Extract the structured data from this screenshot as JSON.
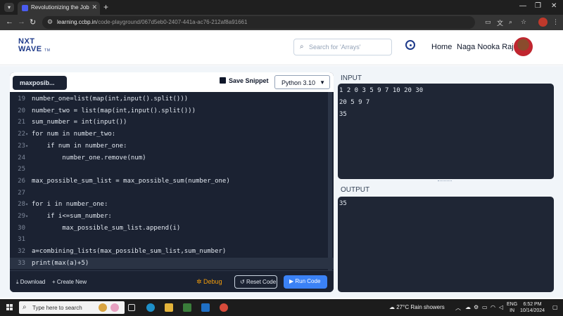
{
  "browser": {
    "tab_title": "Revolutionizing the Job Market",
    "url_host": "learning.ccbp.in",
    "url_path": "/code-playground/067d5eb0-2407-441a-ac76-212af8a91661"
  },
  "header": {
    "logo_line1": "NXT",
    "logo_line2": "WAVE",
    "logo_tm": "TM",
    "search_placeholder": "Search for 'Arrays'",
    "nav_home": "Home",
    "user_name": "Naga Nooka Raju"
  },
  "editor": {
    "file_tab": "maxposib...",
    "save_label": "Save Snippet",
    "language": "Python 3.10",
    "lines": [
      {
        "n": "19",
        "code": "number_one=list(map(int,input().split()))",
        "fold": ""
      },
      {
        "n": "20",
        "code": "number_two = list(map(int,input().split()))",
        "fold": ""
      },
      {
        "n": "21",
        "code": "sum_number = int(input())",
        "fold": ""
      },
      {
        "n": "22",
        "code": "for num in number_two:",
        "fold": "▾"
      },
      {
        "n": "23",
        "code": "    if num in number_one:",
        "fold": "▾"
      },
      {
        "n": "24",
        "code": "        number_one.remove(num)",
        "fold": ""
      },
      {
        "n": "25",
        "code": "",
        "fold": ""
      },
      {
        "n": "26",
        "code": "max_possible_sum_list = max_possible_sum(number_one)",
        "fold": ""
      },
      {
        "n": "27",
        "code": "",
        "fold": ""
      },
      {
        "n": "28",
        "code": "for i in number_one:",
        "fold": "▾"
      },
      {
        "n": "29",
        "code": "    if i<=sum_number:",
        "fold": "▾"
      },
      {
        "n": "30",
        "code": "        max_possible_sum_list.append(i)",
        "fold": ""
      },
      {
        "n": "31",
        "code": "",
        "fold": ""
      },
      {
        "n": "32",
        "code": "a=combining_lists(max_possible_sum_list,sum_number)",
        "fold": ""
      },
      {
        "n": "33",
        "code": "print(max(a)+5)",
        "fold": ""
      }
    ],
    "download_label": "Download",
    "create_new_label": "Create New",
    "debug_label": "Debug",
    "reset_label": "Reset Code",
    "run_label": "Run Code"
  },
  "input": {
    "label": "INPUT",
    "lines": [
      "1 2 0 3 5 9 7 10 20 30",
      "20 5 9 7",
      "35"
    ]
  },
  "output": {
    "label": "OUTPUT",
    "lines": [
      "35"
    ]
  },
  "taskbar": {
    "search_placeholder": "Type here to search",
    "weather": "27°C  Rain showers",
    "lang_line1": "ENG",
    "lang_line2": "IN",
    "time": "6:52 PM",
    "date": "10/14/2024"
  },
  "colors": {
    "editor_bg": "#1b2232",
    "run_button": "#3b82f6",
    "debug": "#f59e0b",
    "brand": "#1e3a8a"
  }
}
